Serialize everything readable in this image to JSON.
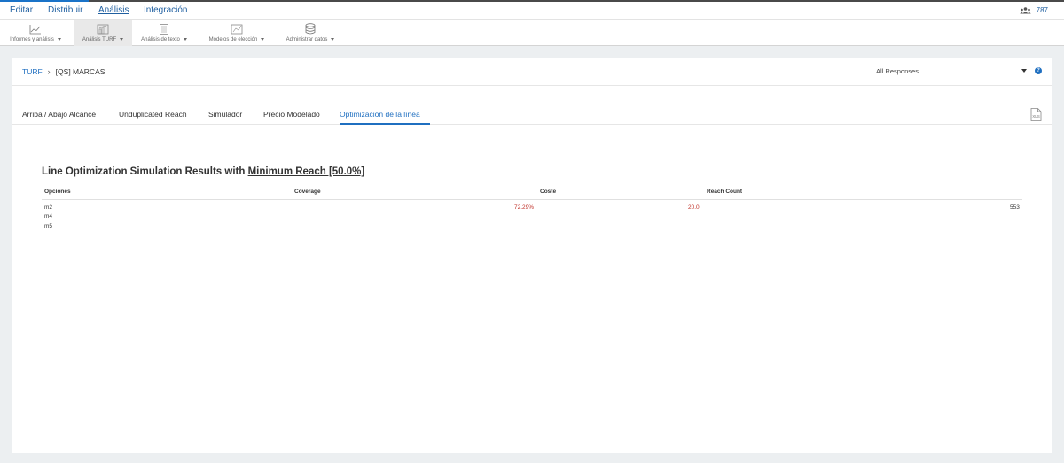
{
  "topnav": {
    "items": [
      "Editar",
      "Distribuir",
      "Análisis",
      "Integración"
    ],
    "active": "Análisis",
    "user_count": "787",
    "users_icon": "users-icon"
  },
  "toolbar": {
    "tools": [
      {
        "label": "Informes y análisis",
        "icon": "line-chart-icon"
      },
      {
        "label": "Análisis TURF",
        "icon": "turf-chart-icon"
      },
      {
        "label": "Análisis de texto",
        "icon": "text-doc-icon"
      },
      {
        "label": "Modelos de elección",
        "icon": "choice-chart-icon"
      },
      {
        "label": "Administrar datos",
        "icon": "database-icon"
      }
    ],
    "selected": "Análisis TURF"
  },
  "breadcrumb": {
    "root": "TURF",
    "current": "[QS] MARCAS"
  },
  "filter": {
    "value": "All Responses",
    "help_icon": "help-icon"
  },
  "tabs": [
    "Arriba / Abajo Alcance",
    "Unduplicated Reach",
    "Simulador",
    "Precio Modelado",
    "Optimización de la línea"
  ],
  "active_tab": "Optimización de la línea",
  "export_icon": "xls-export-icon",
  "results": {
    "title_prefix": "Line Optimization Simulation Results with ",
    "title_link": "Minimum Reach [50.0%]",
    "columns": [
      "Opciones",
      "Coverage",
      "Coste",
      "Reach Count"
    ],
    "options": [
      "m2",
      "m4",
      "m5"
    ],
    "coverage": "72.29%",
    "cost": "20.0",
    "reach_count": "553"
  },
  "colors": {
    "accent": "#1f6fc0",
    "value_red": "#c0322a"
  }
}
